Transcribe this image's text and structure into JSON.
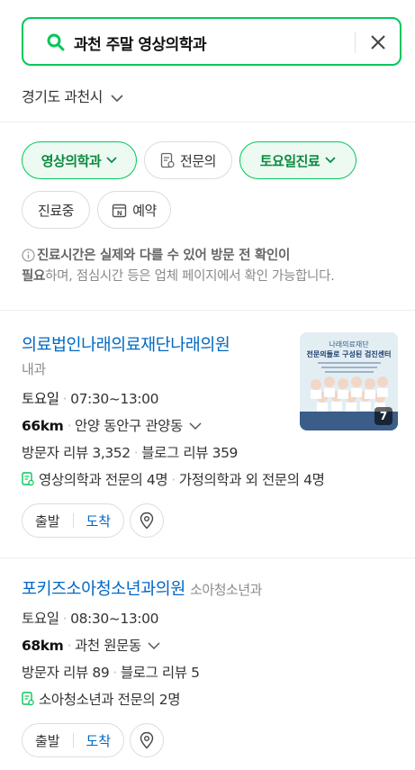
{
  "search": {
    "query": "과천 주말 영상의학과"
  },
  "region": {
    "label": "경기도 과천시"
  },
  "filters": {
    "row1": [
      {
        "label": "영상의학과",
        "active": true,
        "has_chevron": true
      },
      {
        "label": "전문의",
        "active": false,
        "icon": "doc-icon"
      },
      {
        "label": "토요일진료",
        "active": true,
        "has_chevron": true
      }
    ],
    "row2": [
      {
        "label": "진료중",
        "active": false
      },
      {
        "label": "예약",
        "active": false,
        "icon": "calendar-icon"
      }
    ]
  },
  "notice": {
    "bold1": "진료시간은 실제와 다를 수 있어 방문 전 확인이",
    "bold2": "필요",
    "rest": "하며, 점심시간 등은 업체 페이지에서 확인 가능합니다."
  },
  "results": [
    {
      "name": "의료법인나래의료재단나래의원",
      "category": "내과",
      "day": "토요일",
      "hours": "07:30~13:00",
      "distance": "66km",
      "address": "안양 동안구 관양동",
      "visitor_reviews": "방문자 리뷰 3,352",
      "blog_reviews": "블로그 리뷰 359",
      "specialists_a": "영상의학과 전문의 4명",
      "specialists_b": "가정의학과 외 전문의 4명",
      "photo_count": "7",
      "thumb_title": "나래의료재단",
      "thumb_subtitle": "전문의들로 구성된 검진센터",
      "start_label": "출발",
      "arrive_label": "도착"
    },
    {
      "name": "포키즈소아청소년과의원",
      "category": "소아청소년과",
      "day": "토요일",
      "hours": "08:30~13:00",
      "distance": "68km",
      "address": "과천 원문동",
      "visitor_reviews": "방문자 리뷰 89",
      "blog_reviews": "블로그 리뷰 5",
      "specialists_a": "소아청소년과 전문의 2명",
      "start_label": "출발",
      "arrive_label": "도착"
    }
  ],
  "colors": {
    "accent": "#03c75a",
    "link": "#0068c3"
  }
}
